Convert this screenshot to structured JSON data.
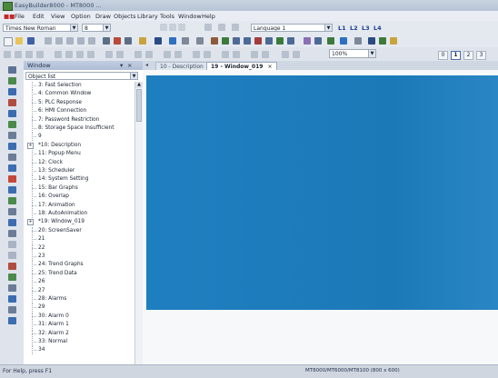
{
  "window": {
    "title": "EasyBuilder8000 - MT8000 ..."
  },
  "menu": [
    "File",
    "Edit",
    "View",
    "Option",
    "Draw",
    "Objects",
    "Library",
    "Tools",
    "Window",
    "Help"
  ],
  "format_toolbar": {
    "font": "Times New Roman",
    "font_size": "8",
    "language": "Language 1",
    "layers": [
      "L1",
      "L2",
      "L3",
      "L4"
    ]
  },
  "zoom": "100%",
  "pages": [
    "0",
    "1",
    "2",
    "3"
  ],
  "panel": {
    "title": "Window",
    "object_list": "Object list"
  },
  "tree": [
    {
      "label": "3: Fast Selection"
    },
    {
      "label": "4: Common Window"
    },
    {
      "label": "5: PLC Response"
    },
    {
      "label": "6: HMI Connection"
    },
    {
      "label": "7: Password Restriction"
    },
    {
      "label": "8: Storage Space Insufficient"
    },
    {
      "label": "9"
    },
    {
      "label": "*10: Description",
      "expander": "+"
    },
    {
      "label": "11: Popup Menu"
    },
    {
      "label": "12: Clock"
    },
    {
      "label": "13: Scheduler"
    },
    {
      "label": "14: System Setting"
    },
    {
      "label": "15: Bar Graphs"
    },
    {
      "label": "16: Overlap"
    },
    {
      "label": "17: Animation"
    },
    {
      "label": "18: AutoAnimation"
    },
    {
      "label": "*19: Window_019",
      "expander": "+"
    },
    {
      "label": "20: ScreenSaver"
    },
    {
      "label": "21"
    },
    {
      "label": "22"
    },
    {
      "label": "23"
    },
    {
      "label": "24: Trend Graphs"
    },
    {
      "label": "25: Trend Data"
    },
    {
      "label": "26"
    },
    {
      "label": "27"
    },
    {
      "label": "28: Alarms"
    },
    {
      "label": "29"
    },
    {
      "label": "30: Alarm 0"
    },
    {
      "label": "31: Alarm 1"
    },
    {
      "label": "32: Alarm 2"
    },
    {
      "label": "33: Normal"
    },
    {
      "label": "34"
    }
  ],
  "tabs": [
    {
      "label": "10 - Description"
    },
    {
      "label": "19 - Window_019",
      "close": "×"
    }
  ],
  "status": {
    "left": "For Help, press F1",
    "right": "MT8000/MT6000/MT8100 (800 x 600)"
  },
  "colors": {
    "canvas": "#1e7fc0",
    "chrome": "#d6dbe3"
  }
}
